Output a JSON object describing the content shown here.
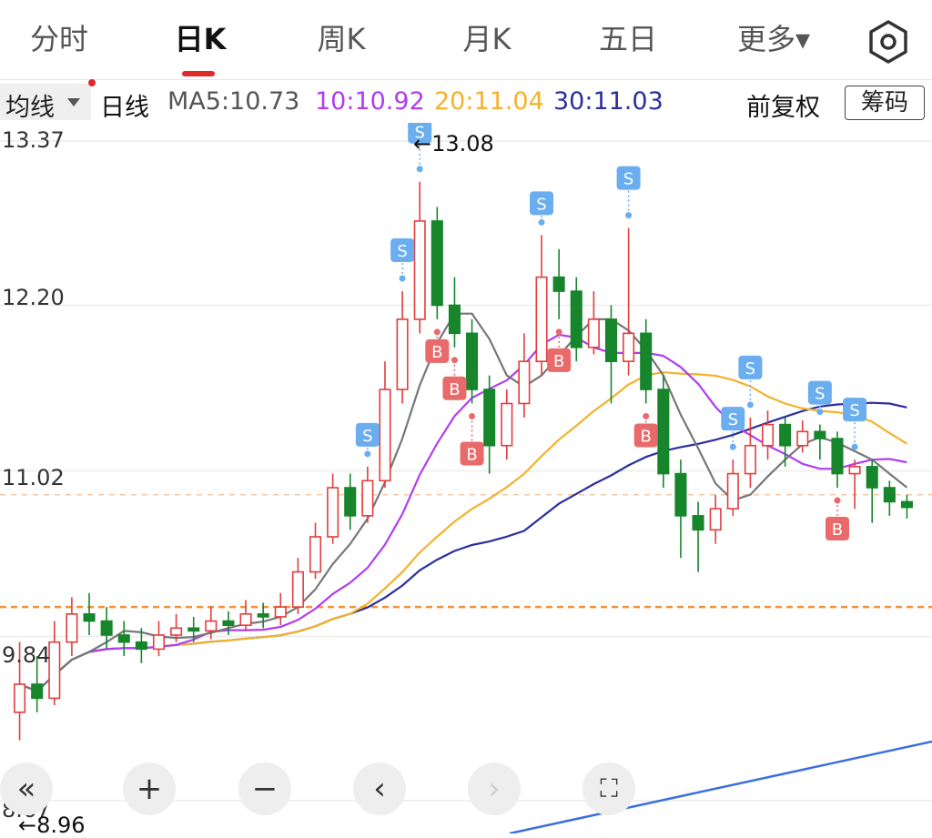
{
  "tabs": [
    {
      "label": "分时",
      "active": false
    },
    {
      "label": "日K",
      "active": true
    },
    {
      "label": "周K",
      "active": false
    },
    {
      "label": "月K",
      "active": false
    },
    {
      "label": "五日",
      "active": false
    },
    {
      "label": "更多▾",
      "active": false
    }
  ],
  "settings_icon": "gear-icon",
  "legend": {
    "ma_selector": "均线",
    "period": "日线",
    "ma5": "MA5:10.73",
    "ma10": "10:10.92",
    "ma20": "20:11.04",
    "ma30": "30:11.03",
    "adjust": "前复权",
    "chips_button": "筹码"
  },
  "colors": {
    "up": "#e23d3d",
    "down": "#16852b",
    "ma5": "#777777",
    "ma10": "#b13cf2",
    "ma20": "#f4b22a",
    "ma30": "#2d2f9c",
    "sell_marker": "#6aaef0",
    "buy_marker": "#e96a6a",
    "trend_line": "#3b6fe0"
  },
  "y_axis": {
    "labels": [
      "13.37",
      "12.20",
      "11.02",
      "9.84",
      "8.67"
    ]
  },
  "annotations": {
    "max_label": "←13.08",
    "min_label": "←8.96"
  },
  "controls": [
    {
      "name": "scroll-left-fast",
      "glyph": "«",
      "enabled": true
    },
    {
      "name": "zoom-in",
      "glyph": "+",
      "enabled": true
    },
    {
      "name": "zoom-out",
      "glyph": "−",
      "enabled": true
    },
    {
      "name": "step-left",
      "glyph": "‹",
      "enabled": true
    },
    {
      "name": "step-right",
      "glyph": "›",
      "enabled": false
    },
    {
      "name": "fullscreen",
      "glyph": "⛶",
      "enabled": true
    }
  ],
  "chart_data": {
    "type": "candlestick",
    "y_range": [
      8.67,
      13.37
    ],
    "ref_lines": [
      10.05,
      10.85
    ],
    "candles": [
      [
        9.3,
        9.5,
        9.8,
        9.1
      ],
      [
        9.5,
        9.4,
        9.7,
        9.3
      ],
      [
        9.4,
        9.8,
        9.95,
        9.35
      ],
      [
        9.8,
        10.0,
        10.12,
        9.7
      ],
      [
        10.0,
        9.95,
        10.15,
        9.85
      ],
      [
        9.95,
        9.85,
        10.05,
        9.75
      ],
      [
        9.85,
        9.8,
        9.95,
        9.7
      ],
      [
        9.8,
        9.75,
        9.9,
        9.65
      ],
      [
        9.75,
        9.85,
        9.95,
        9.7
      ],
      [
        9.85,
        9.9,
        10.0,
        9.8
      ],
      [
        9.9,
        9.88,
        9.98,
        9.8
      ],
      [
        9.88,
        9.95,
        10.05,
        9.82
      ],
      [
        9.95,
        9.92,
        10.02,
        9.85
      ],
      [
        9.92,
        10.0,
        10.1,
        9.88
      ],
      [
        10.0,
        9.98,
        10.08,
        9.9
      ],
      [
        9.98,
        10.05,
        10.15,
        9.92
      ],
      [
        10.05,
        10.3,
        10.4,
        10.0
      ],
      [
        10.3,
        10.55,
        10.65,
        10.25
      ],
      [
        10.55,
        10.9,
        11.0,
        10.5
      ],
      [
        10.9,
        10.7,
        11.0,
        10.6
      ],
      [
        10.7,
        10.95,
        11.05,
        10.65
      ],
      [
        10.95,
        11.6,
        11.8,
        10.9
      ],
      [
        11.6,
        12.1,
        12.3,
        11.5
      ],
      [
        12.1,
        12.8,
        13.08,
        12.0
      ],
      [
        12.8,
        12.2,
        12.9,
        12.1
      ],
      [
        12.2,
        12.0,
        12.4,
        11.9
      ],
      [
        12.0,
        11.6,
        12.1,
        11.5
      ],
      [
        11.6,
        11.2,
        11.7,
        11.0
      ],
      [
        11.2,
        11.5,
        11.6,
        11.1
      ],
      [
        11.5,
        11.8,
        12.0,
        11.4
      ],
      [
        11.8,
        12.4,
        12.7,
        11.7
      ],
      [
        12.4,
        12.3,
        12.6,
        12.1
      ],
      [
        12.3,
        11.9,
        12.4,
        11.8
      ],
      [
        11.9,
        12.1,
        12.3,
        11.85
      ],
      [
        12.1,
        11.8,
        12.2,
        11.5
      ],
      [
        11.8,
        12.0,
        12.75,
        11.7
      ],
      [
        12.0,
        11.6,
        12.1,
        11.5
      ],
      [
        11.6,
        11.0,
        11.7,
        10.9
      ],
      [
        11.0,
        10.7,
        11.1,
        10.4
      ],
      [
        10.7,
        10.6,
        10.8,
        10.3
      ],
      [
        10.6,
        10.75,
        10.85,
        10.5
      ],
      [
        10.75,
        11.0,
        11.1,
        10.7
      ],
      [
        11.0,
        11.2,
        11.4,
        10.9
      ],
      [
        11.2,
        11.35,
        11.45,
        11.1
      ],
      [
        11.35,
        11.2,
        11.4,
        11.05
      ],
      [
        11.2,
        11.3,
        11.38,
        11.15
      ],
      [
        11.3,
        11.25,
        11.35,
        11.1
      ],
      [
        11.25,
        11.0,
        11.3,
        10.9
      ],
      [
        11.0,
        11.05,
        11.1,
        10.75
      ],
      [
        11.05,
        10.9,
        11.1,
        10.65
      ],
      [
        10.9,
        10.8,
        10.95,
        10.7
      ],
      [
        10.8,
        10.76,
        10.85,
        10.68
      ]
    ],
    "signals": [
      {
        "idx": 20,
        "type": "S"
      },
      {
        "idx": 22,
        "type": "S"
      },
      {
        "idx": 23,
        "type": "S"
      },
      {
        "idx": 24,
        "type": "B"
      },
      {
        "idx": 25,
        "type": "B"
      },
      {
        "idx": 26,
        "type": "B"
      },
      {
        "idx": 30,
        "type": "S"
      },
      {
        "idx": 31,
        "type": "B"
      },
      {
        "idx": 35,
        "type": "S"
      },
      {
        "idx": 36,
        "type": "B"
      },
      {
        "idx": 41,
        "type": "S"
      },
      {
        "idx": 42,
        "type": "S"
      },
      {
        "idx": 46,
        "type": "S"
      },
      {
        "idx": 47,
        "type": "B"
      },
      {
        "idx": 48,
        "type": "S"
      }
    ]
  }
}
